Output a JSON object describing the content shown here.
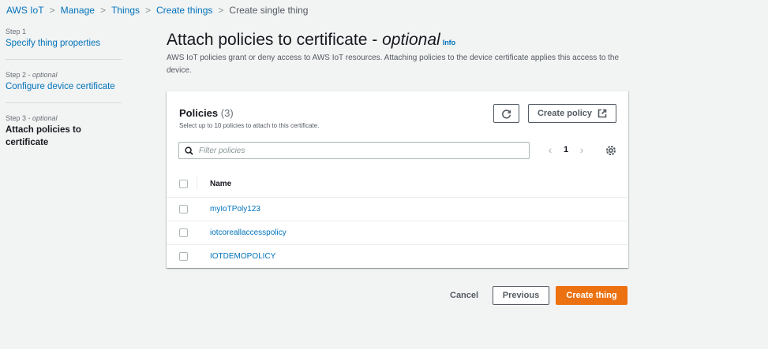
{
  "breadcrumb": {
    "items": [
      "AWS IoT",
      "Manage",
      "Things",
      "Create things"
    ],
    "current": "Create single thing"
  },
  "steps": [
    {
      "step": "Step 1",
      "optional": "",
      "label": "Specify thing properties"
    },
    {
      "step": "Step 2",
      "optional": "optional",
      "label": "Configure device certificate"
    },
    {
      "step": "Step 3",
      "optional": "optional",
      "label": "Attach policies to certificate"
    }
  ],
  "header": {
    "title": "Attach policies to certificate - ",
    "title_optional": "optional",
    "info": "Info",
    "description": "AWS IoT policies grant or deny access to AWS IoT resources. Attaching policies to the device certificate applies this access to the device."
  },
  "panel": {
    "title": "Policies",
    "count": "(3)",
    "subtitle": "Select up to 10 policies to attach to this certificate.",
    "create_policy_label": "Create policy",
    "filter_placeholder": "Filter policies",
    "page": "1",
    "column_name": "Name",
    "rows": [
      "myIoTPoly123",
      "iotcoreallaccesspolicy",
      "IOTDEMOPOLICY"
    ]
  },
  "footer": {
    "cancel": "Cancel",
    "previous": "Previous",
    "create_thing": "Create thing"
  },
  "colors": {
    "accent": "#ec7211",
    "link": "#0073bb",
    "background": "#f2f3f3"
  }
}
